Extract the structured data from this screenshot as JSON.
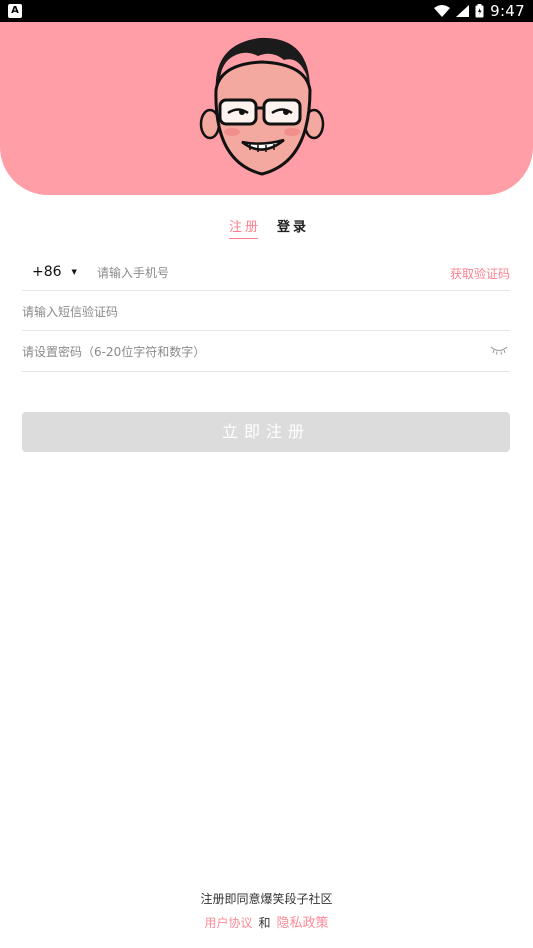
{
  "status_bar": {
    "time": "9:47",
    "notification_icon": "app-notification-icon",
    "icons": [
      "wifi-icon",
      "signal-icon",
      "battery-icon"
    ]
  },
  "header": {
    "background_color": "#ff9ea7",
    "mascot": "cartoon-face-with-glasses"
  },
  "tabs": [
    {
      "label": "注册",
      "active": true
    },
    {
      "label": "登录",
      "active": false
    }
  ],
  "form": {
    "country_code": "+86",
    "phone_placeholder": "请输入手机号",
    "get_code_label": "获取验证码",
    "sms_placeholder": "请输入短信验证码",
    "password_placeholder": "请设置密码（6-20位字符和数字）",
    "submit_label": "立即注册"
  },
  "footer": {
    "agreement_text": "注册即同意爆笑段子社区",
    "user_agreement": "用户协议",
    "and": "和",
    "privacy_policy": "隐私政策"
  },
  "colors": {
    "accent": "#ff7f8e",
    "header": "#ff9ea7",
    "button_disabled": "#dcdcdc"
  }
}
